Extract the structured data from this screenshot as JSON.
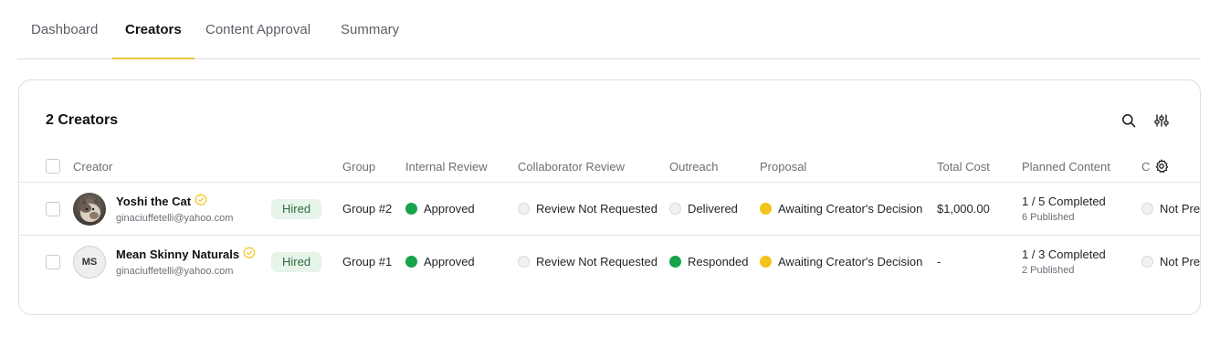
{
  "tabs": [
    {
      "label": "Dashboard",
      "active": false
    },
    {
      "label": "Creators",
      "active": true
    },
    {
      "label": "Content Approval",
      "active": false
    },
    {
      "label": "Summary",
      "active": false
    }
  ],
  "card": {
    "title": "2 Creators",
    "search_icon": "search-icon",
    "filter_icon": "sliders-icon"
  },
  "columns": {
    "creator": "Creator",
    "group": "Group",
    "internal_review": "Internal Review",
    "collaborator_review": "Collaborator Review",
    "outreach": "Outreach",
    "proposal": "Proposal",
    "total_cost": "Total Cost",
    "planned_content": "Planned Content",
    "truncated": "C",
    "settings_icon": "gear-icon"
  },
  "rows": [
    {
      "avatar": "cat-photo",
      "name": "Yoshi the Cat",
      "email": "ginaciuffetelli@yahoo.com",
      "status": "Hired",
      "group": "Group #2",
      "internal_review": "Approved",
      "collaborator_review": "Review Not Requested",
      "outreach": "Delivered",
      "proposal": "Awaiting Creator's Decision",
      "total_cost": "$1,000.00",
      "planned_main": "1 / 5 Completed",
      "planned_sub": "6 Published",
      "last_col": "Not Prep"
    },
    {
      "avatar_initials": "MS",
      "name": "Mean Skinny Naturals",
      "email": "ginaciuffetelli@yahoo.com",
      "status": "Hired",
      "group": "Group #1",
      "internal_review": "Approved",
      "collaborator_review": "Review Not Requested",
      "outreach": "Responded",
      "proposal": "Awaiting Creator's Decision",
      "total_cost": "-",
      "planned_main": "1 / 3 Completed",
      "planned_sub": "2 Published",
      "last_col": "Not Prep"
    }
  ],
  "colors": {
    "accent_underline": "#e8c33a",
    "status_green": "#17a34a",
    "status_yellow": "#f2c418",
    "badge_bg": "#e6f4ea",
    "verified_badge": "#f2c418"
  }
}
